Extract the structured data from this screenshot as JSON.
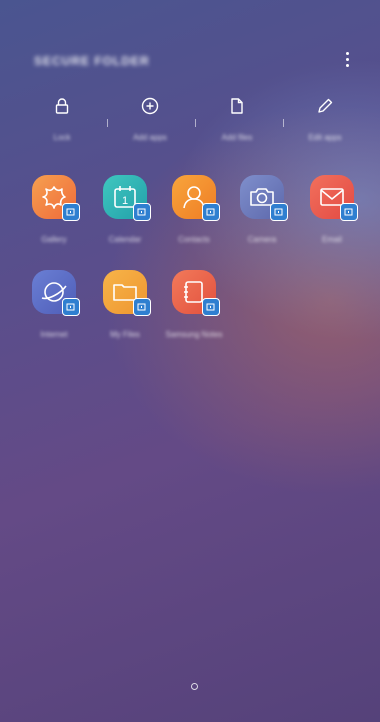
{
  "header": {
    "title": "SECURE FOLDER"
  },
  "actions": [
    {
      "label": "Lock",
      "icon": "lock-icon"
    },
    {
      "label": "Add apps",
      "icon": "add-circle-icon"
    },
    {
      "label": "Add files",
      "icon": "file-icon"
    },
    {
      "label": "Edit apps",
      "icon": "pencil-icon"
    }
  ],
  "apps": [
    {
      "name": "Gallery",
      "color": "#f0803a"
    },
    {
      "name": "Calendar",
      "color": "#2cb0b2"
    },
    {
      "name": "Contacts",
      "color": "#f08a2c"
    },
    {
      "name": "Camera",
      "color": "#6b78b8"
    },
    {
      "name": "Email",
      "color": "#ec5a4e"
    },
    {
      "name": "Internet",
      "color": "#5a6cc4"
    },
    {
      "name": "My Files",
      "color": "#f0a03a"
    },
    {
      "name": "Samsung Notes",
      "color": "#e9604a"
    }
  ],
  "colors": {
    "badge": "#2f7fd0"
  }
}
